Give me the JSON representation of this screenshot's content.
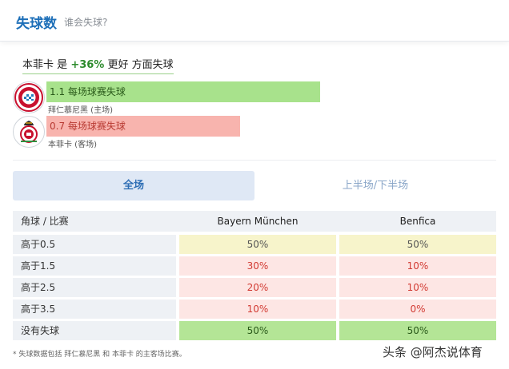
{
  "header": {
    "title": "失球数",
    "subtitle": "谁会失球?"
  },
  "summary": {
    "team": "本菲卡",
    "is": "是",
    "pct": "+36%",
    "better": "更好",
    "aspect": "方面失球"
  },
  "teams": [
    {
      "bar_label": "1.1 每场球赛失球",
      "name": "拜仁慕尼黑 (主场)",
      "logo": "bayern-logo"
    },
    {
      "bar_label": "0.7 每场球赛失球",
      "name": "本菲卡 (客场)",
      "logo": "benfica-logo"
    }
  ],
  "tabs": [
    {
      "label": "全场",
      "active": true
    },
    {
      "label": "上半场/下半场",
      "active": false
    }
  ],
  "table": {
    "headers": [
      "角球 / 比赛",
      "Bayern München",
      "Benfica"
    ],
    "rows": [
      {
        "label": "高于0.5",
        "home": "50%",
        "away": "50%"
      },
      {
        "label": "高于1.5",
        "home": "30%",
        "away": "10%"
      },
      {
        "label": "高于2.5",
        "home": "20%",
        "away": "10%"
      },
      {
        "label": "高于3.5",
        "home": "10%",
        "away": "0%"
      },
      {
        "label": "没有失球",
        "home": "50%",
        "away": "50%"
      }
    ]
  },
  "footnote": "* 失球数据包括 拜仁慕尼黑 和 本菲卡 的主客场比赛。",
  "watermark": "头条 @阿杰说体育",
  "colors": {
    "accent": "#1d6fb8",
    "home_bar": "#a8e28c",
    "away_bar": "#f8b4ae",
    "positive": "#2e8b2e"
  }
}
